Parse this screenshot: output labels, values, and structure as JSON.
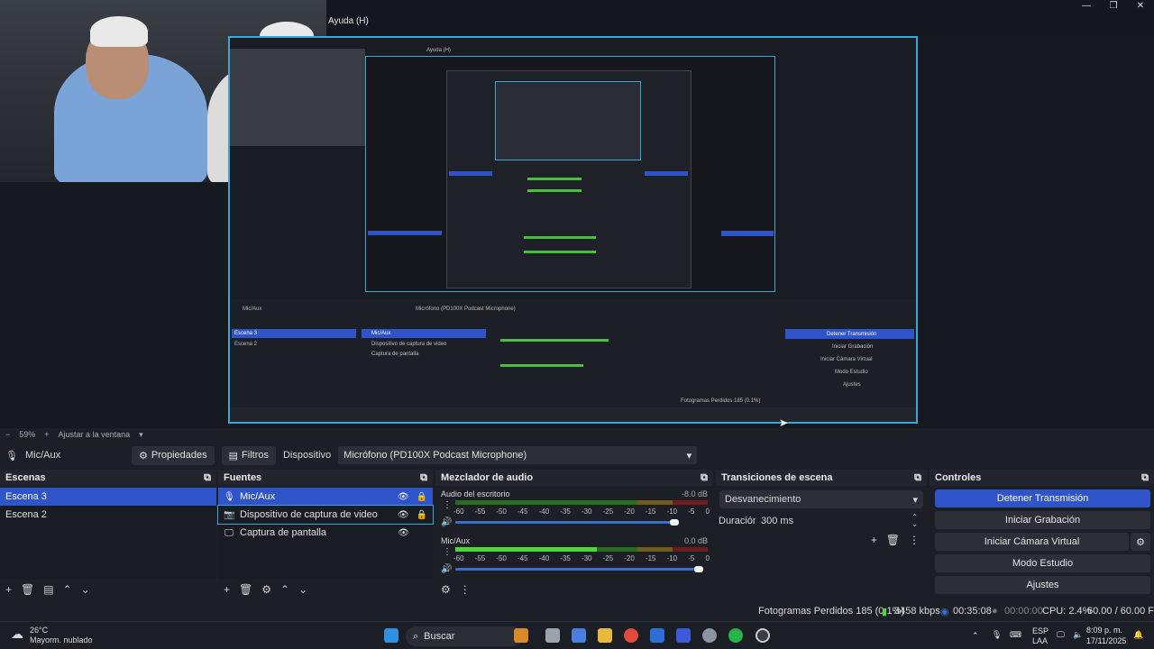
{
  "projector": {
    "title": "Ayuda (H)",
    "window_controls": [
      "—",
      "❐",
      "✕"
    ]
  },
  "nested": {
    "title": "Ayuda (H)",
    "scenes": [
      "Escena 3",
      "Escena 2"
    ],
    "sources": [
      "Mic/Aux",
      "Dispositivo de captura de video",
      "Captura de pantalla"
    ],
    "controls": [
      "Detener Transmisión",
      "Iniciar Grabación",
      "Iniciar Cámara Virtual",
      "Modo Estudio",
      "Ajustes"
    ],
    "device": "Micrófono (PD100X Podcast Microphone)",
    "status": "Fotogramas Perdidos 185 (0.1%)"
  },
  "zoom": {
    "minus": "−",
    "value": "59%",
    "plus": "+",
    "fit": "Ajustar a la ventana"
  },
  "source_toolbar": {
    "source_name": "Mic/Aux",
    "properties": "Propiedades",
    "filters": "Filtros",
    "device_label": "Dispositivo",
    "device_value": "Micrófono (PD100X Podcast Microphone)"
  },
  "scenes": {
    "title": "Escenas",
    "items": [
      {
        "label": "Escena 3",
        "selected": true
      },
      {
        "label": "Escena 2",
        "selected": false
      }
    ]
  },
  "sources": {
    "title": "Fuentes",
    "items": [
      {
        "label": "Mic/Aux",
        "icon": "microphone-icon",
        "selected": true
      },
      {
        "label": "Dispositivo de captura de video",
        "icon": "camera-icon",
        "selected": false
      },
      {
        "label": "Captura de pantalla",
        "icon": "monitor-icon",
        "selected": false
      }
    ]
  },
  "mixer": {
    "title": "Mezclador de audio",
    "channels": [
      {
        "name": "Audio del escritorio",
        "db": "-8.0 dB",
        "level": 0.0,
        "volume": 0.9
      },
      {
        "name": "Mic/Aux",
        "db": "0.0 dB",
        "level": 0.56,
        "volume": 1.0
      }
    ],
    "ticks": [
      "-60",
      "-55",
      "-50",
      "-45",
      "-40",
      "-35",
      "-30",
      "-25",
      "-20",
      "-15",
      "-10",
      "-5",
      "0"
    ]
  },
  "transitions": {
    "title": "Transiciones de escena",
    "selected": "Desvanecimiento",
    "duration_label": "Duración",
    "duration_value": "300 ms"
  },
  "controls": {
    "title": "Controles",
    "buttons": [
      "Detener Transmisión",
      "Iniciar Grabación",
      "Iniciar Cámara Virtual",
      "Modo Estudio",
      "Ajustes"
    ]
  },
  "status": {
    "dropped": "Fotogramas Perdidos 185 (0.1%)",
    "bitrate": "3458 kbps",
    "stream_time": "00:35:08",
    "rec_time": "00:00:00",
    "cpu": "CPU: 2.4%",
    "fps": "60.00 / 60.00 FPS"
  },
  "taskbar": {
    "weather_temp": "26°C",
    "weather_desc": "Mayorm. nublado",
    "search": "Buscar",
    "lang1": "ESP",
    "lang2": "LAA",
    "time": "8:09 p. m.",
    "date": "17/11/2025"
  },
  "colors": {
    "accent": "#2f53c9",
    "border_highlight": "#3aa7d8",
    "meter_green": "#4fd63f"
  }
}
